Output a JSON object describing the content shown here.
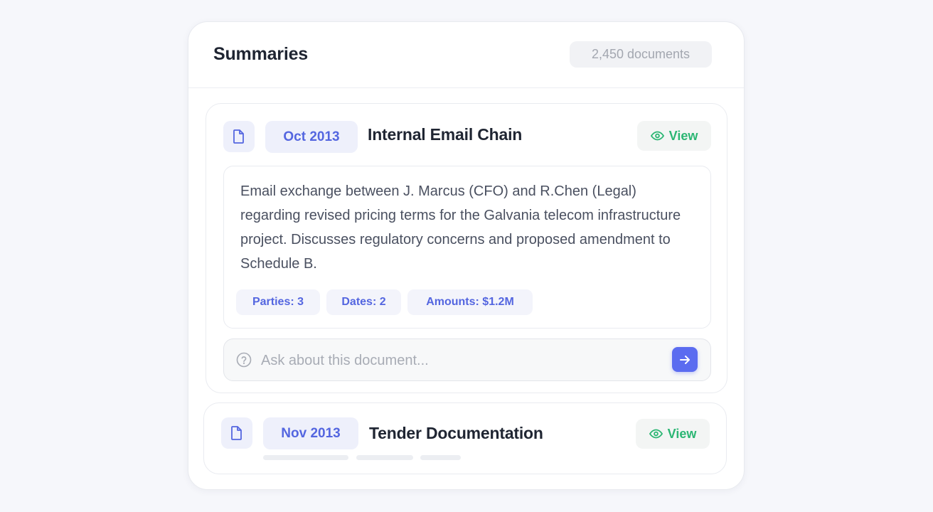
{
  "header": {
    "title": "Summaries",
    "document_count": "2,450 documents"
  },
  "documents": [
    {
      "date": "Oct 2013",
      "title": "Internal Email Chain",
      "view_label": "View",
      "summary": "Email exchange between J. Marcus (CFO) and R.Chen (Legal) regarding revised pricing terms for the Galvania telecom infrastructure project. Discusses regulatory concerns and proposed amendment to Schedule B.",
      "tags": [
        "Parties: 3",
        "Dates: 2",
        "Amounts: $1.2M"
      ],
      "ask_placeholder": "Ask about this document...",
      "icons": {
        "file": "file-icon",
        "view": "eye-icon",
        "ask": "question-circle-icon",
        "send": "arrow-right-icon"
      }
    },
    {
      "date": "Nov 2013",
      "title": "Tender Documentation",
      "view_label": "View",
      "loading": true,
      "icons": {
        "file": "file-icon",
        "view": "eye-icon"
      }
    }
  ],
  "colors": {
    "accent": "#5466e0",
    "send_button": "#5b6cf0",
    "view_green": "#2bb673",
    "chip_bg": "#eef0fb",
    "page_bg": "#f6f7fb"
  }
}
